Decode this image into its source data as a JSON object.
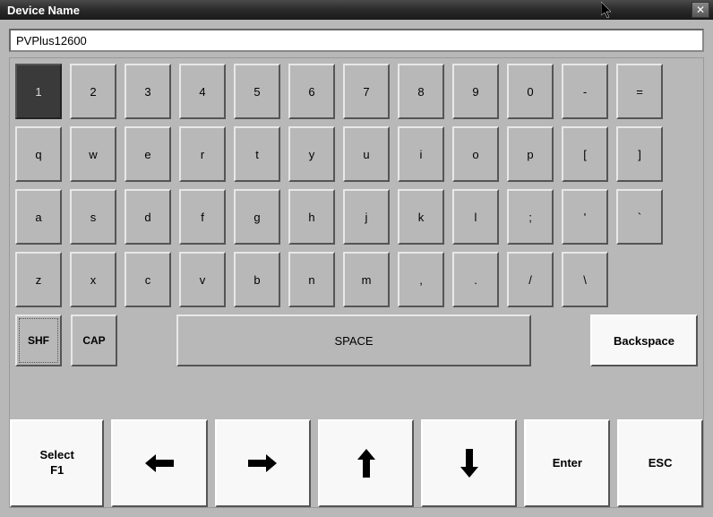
{
  "title": "Device Name",
  "input": {
    "value": "PVPlus12600"
  },
  "rows": {
    "r1": [
      "1",
      "2",
      "3",
      "4",
      "5",
      "6",
      "7",
      "8",
      "9",
      "0",
      "-",
      "="
    ],
    "r2": [
      "q",
      "w",
      "e",
      "r",
      "t",
      "y",
      "u",
      "i",
      "o",
      "p",
      "[",
      "]"
    ],
    "r3": [
      "a",
      "s",
      "d",
      "f",
      "g",
      "h",
      "j",
      "k",
      "l",
      ";",
      "'",
      "`"
    ],
    "r4": [
      "z",
      "x",
      "c",
      "v",
      "b",
      "n",
      "m",
      ",",
      ".",
      "/",
      "\\"
    ]
  },
  "keys": {
    "shf": "SHF",
    "cap": "CAP",
    "space": "SPACE",
    "backspace": "Backspace",
    "select": "Select",
    "f1": "F1",
    "enter": "Enter",
    "esc": "ESC"
  }
}
